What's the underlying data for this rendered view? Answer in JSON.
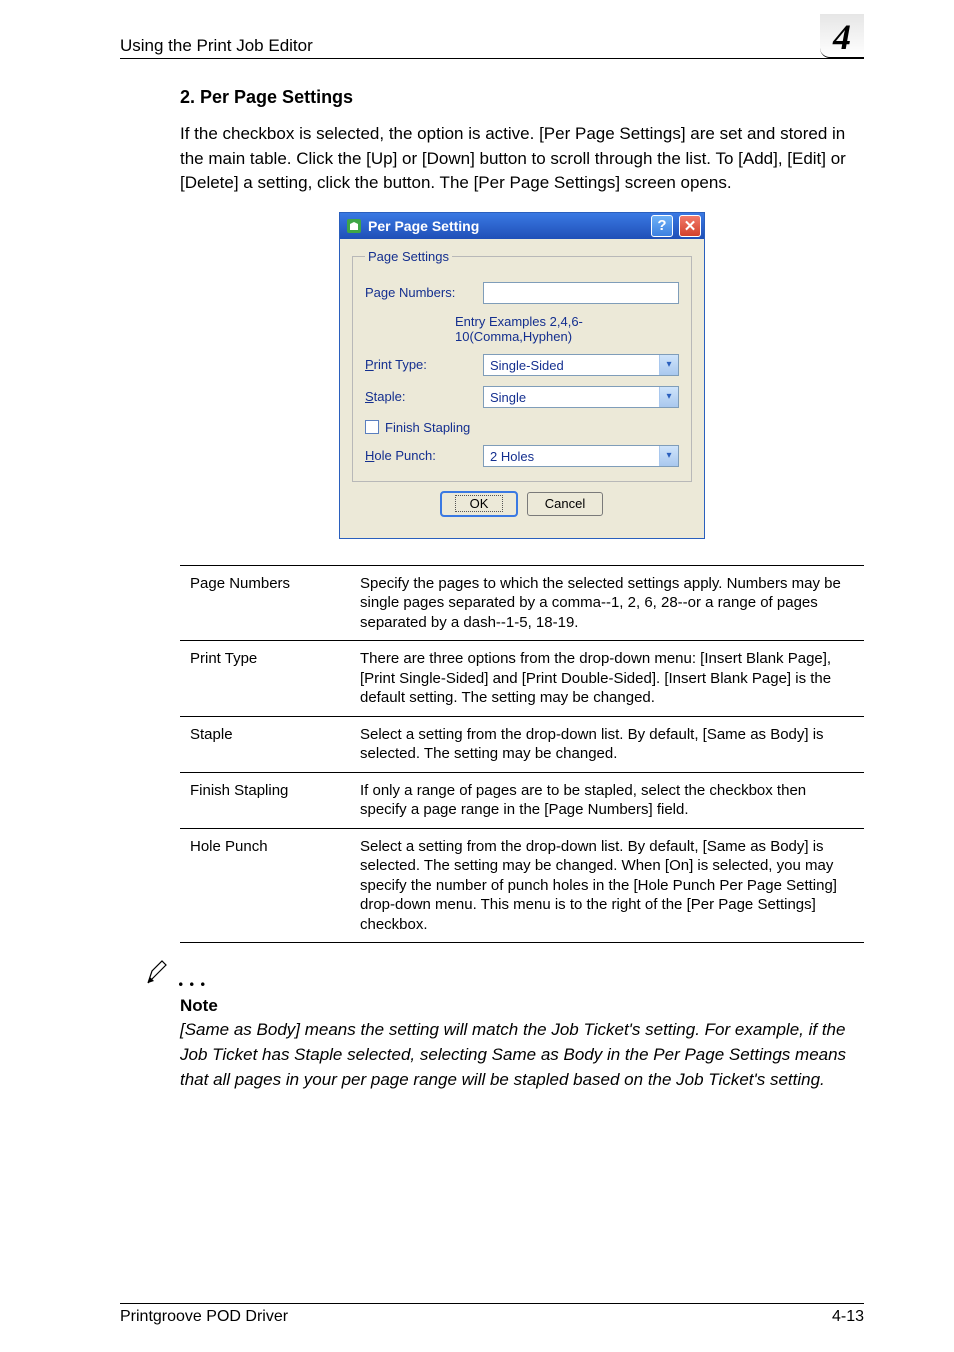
{
  "header": {
    "section_title": "Using the Print Job Editor",
    "chapter_number": "4"
  },
  "section": {
    "heading": "2. Per Page Settings",
    "paragraph": "If the checkbox is selected, the option is active. [Per Page Settings] are set and stored in the main table. Click the [Up] or [Down] button to scroll through the list. To [Add], [Edit] or [Delete] a setting, click the button. The [Per Page Settings] screen opens."
  },
  "dialog": {
    "title": "Per Page Setting",
    "help_symbol": "?",
    "close_symbol": "✕",
    "group_legend": "Page Settings",
    "page_numbers_label_pre": "Pa",
    "page_numbers_label_ul": "g",
    "page_numbers_label_post": "e Numbers:",
    "page_numbers_value": "",
    "entry_examples": "Entry Examples 2,4,6-10(Comma,Hyphen)",
    "print_type_label_ul": "P",
    "print_type_label_post": "rint Type:",
    "print_type_value": "Single-Sided",
    "staple_label_ul": "S",
    "staple_label_post": "taple:",
    "staple_value": "Single",
    "finish_stapling_label_ul": "F",
    "finish_stapling_label_post": "inish Stapling",
    "hole_punch_label_ul": "H",
    "hole_punch_label_post": "ole Punch:",
    "hole_punch_value": "2 Holes",
    "ok_label": "OK",
    "cancel_label": "Cancel"
  },
  "table": {
    "rows": [
      {
        "key": "Page Numbers",
        "desc": "Specify the pages to which the selected settings apply. Numbers may be single pages separated by a comma--1, 2, 6, 28--or a range of pages separated by a dash--1-5, 18-19."
      },
      {
        "key": "Print Type",
        "desc": "There are three options from the drop-down menu: [Insert Blank Page], [Print Single-Sided] and [Print Double-Sided]. [Insert Blank Page] is the default setting. The setting may be changed."
      },
      {
        "key": "Staple",
        "desc": "Select a setting from the drop-down list. By default, [Same as Body] is selected. The setting may be changed."
      },
      {
        "key": "Finish Stapling",
        "desc": "If only a range of pages are to be stapled, select the checkbox then specify a page range in the [Page Numbers] field."
      },
      {
        "key": "Hole Punch",
        "desc": "Select a setting from the drop-down list. By default, [Same as Body] is selected. The setting may be changed. When [On] is selected, you may specify the number of punch holes in the [Hole Punch Per Page Setting] drop-down menu. This menu is to the right of the [Per Page Settings] checkbox."
      }
    ]
  },
  "note": {
    "dots": ". . .",
    "heading": "Note",
    "body": "[Same as Body] means the setting will match the Job Ticket's setting. For example, if the Job Ticket has Staple selected, selecting Same as Body in the Per Page Settings means that all pages in your per page range will be stapled based on the Job Ticket's setting."
  },
  "footer": {
    "product": "Printgroove POD Driver",
    "page": "4-13"
  }
}
